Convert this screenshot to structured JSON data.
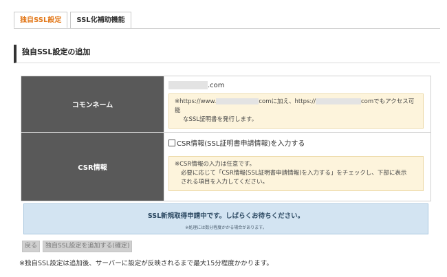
{
  "tabs": [
    {
      "label": "独自SSL設定",
      "active": true
    },
    {
      "label": "SSL化補助機能",
      "active": false
    }
  ],
  "section_title": "独自SSL設定の追加",
  "form": {
    "common_name": {
      "label": "コモンネーム",
      "domain_suffix": ".com",
      "note_prefix": "※https://www.",
      "note_mid": "comに加え、https://",
      "note_suffix": "comでもアクセス可能",
      "note_line2": "なSSL証明書を発行します。"
    },
    "csr": {
      "label": "CSR情報",
      "checkbox_label": "CSR情報(SSL証明書申請情報)を入力する",
      "checkbox_checked": false,
      "note_line1": "※CSR情報の入力は任意です。",
      "note_line2": "必要に応じて「CSR情報(SSL証明書申請情報)を入力する」をチェックし、下部に表示",
      "note_line3": "される項目を入力してください。"
    }
  },
  "notice": {
    "main": "SSL新規取得申請中です。しばらくお待ちください。",
    "sub": "※処理には数分程度かかる場合があります。"
  },
  "buttons": {
    "back": "戻る",
    "confirm": "独自SSL設定を追加する(確定)"
  },
  "footnote": "※独自SSL設定は追加後、サーバーに設定が反映されるまで最大15分程度かかります。",
  "colors": {
    "active_tab": "#e2781a",
    "header_cell": "#595959",
    "note_bg": "#fdf4dc",
    "notice_bg": "#d3e4f2"
  }
}
